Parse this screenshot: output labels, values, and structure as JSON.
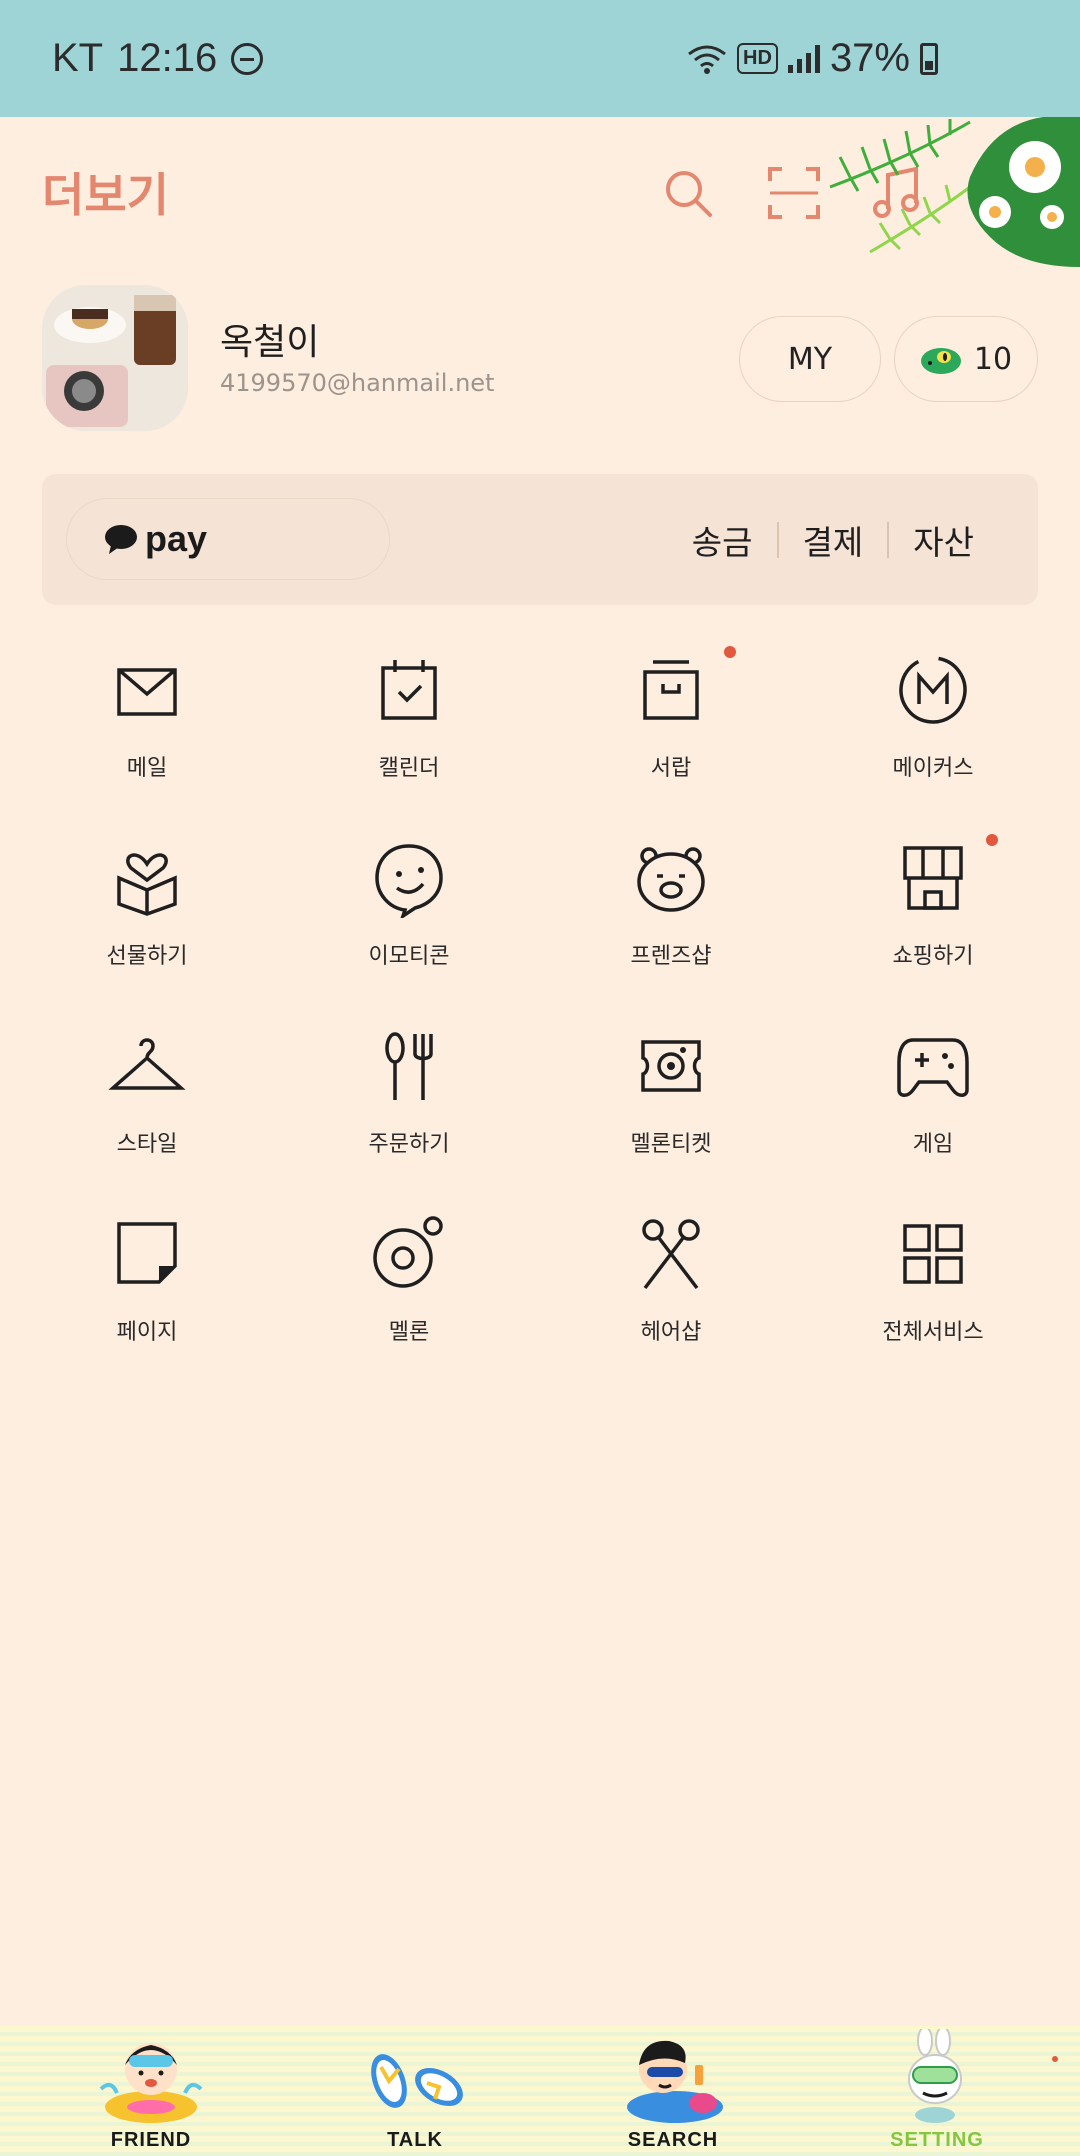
{
  "status_bar": {
    "carrier": "KT",
    "time": "12:16",
    "network_badge": "HD",
    "battery": "37%"
  },
  "header": {
    "title": "더보기",
    "icons": [
      "search-icon",
      "scan-icon",
      "music-icon",
      "settings-icon"
    ]
  },
  "profile": {
    "name": "옥철이",
    "email": "4199570@hanmail.net",
    "my_label": "MY",
    "coin_count": "10"
  },
  "pay": {
    "label": "pay",
    "links": [
      "송금",
      "결제",
      "자산"
    ]
  },
  "services": [
    {
      "label": "메일",
      "icon": "mail-icon",
      "badge": false
    },
    {
      "label": "캘린더",
      "icon": "calendar-icon",
      "badge": false
    },
    {
      "label": "서랍",
      "icon": "drawer-icon",
      "badge": true
    },
    {
      "label": "메이커스",
      "icon": "makers-icon",
      "badge": false
    },
    {
      "label": "선물하기",
      "icon": "gift-icon",
      "badge": false
    },
    {
      "label": "이모티콘",
      "icon": "emoticon-icon",
      "badge": false
    },
    {
      "label": "프렌즈샵",
      "icon": "friends-shop-icon",
      "badge": false
    },
    {
      "label": "쇼핑하기",
      "icon": "shopping-icon",
      "badge": true
    },
    {
      "label": "스타일",
      "icon": "hanger-icon",
      "badge": false
    },
    {
      "label": "주문하기",
      "icon": "order-icon",
      "badge": false
    },
    {
      "label": "멜론티켓",
      "icon": "ticket-icon",
      "badge": false
    },
    {
      "label": "게임",
      "icon": "game-icon",
      "badge": false
    },
    {
      "label": "페이지",
      "icon": "page-icon",
      "badge": false
    },
    {
      "label": "멜론",
      "icon": "melon-icon",
      "badge": false
    },
    {
      "label": "헤어샵",
      "icon": "scissors-icon",
      "badge": false
    },
    {
      "label": "전체서비스",
      "icon": "all-services-icon",
      "badge": false
    }
  ],
  "bottom_nav": [
    {
      "label": "FRIEND",
      "active": false
    },
    {
      "label": "TALK",
      "active": false
    },
    {
      "label": "SEARCH",
      "active": false
    },
    {
      "label": "SETTING",
      "active": true
    }
  ],
  "colors": {
    "background": "#fdeee0",
    "status_bar": "#9fd4d7",
    "accent": "#e3876f",
    "badge": "#e2583e",
    "active_tab": "#84c640"
  }
}
